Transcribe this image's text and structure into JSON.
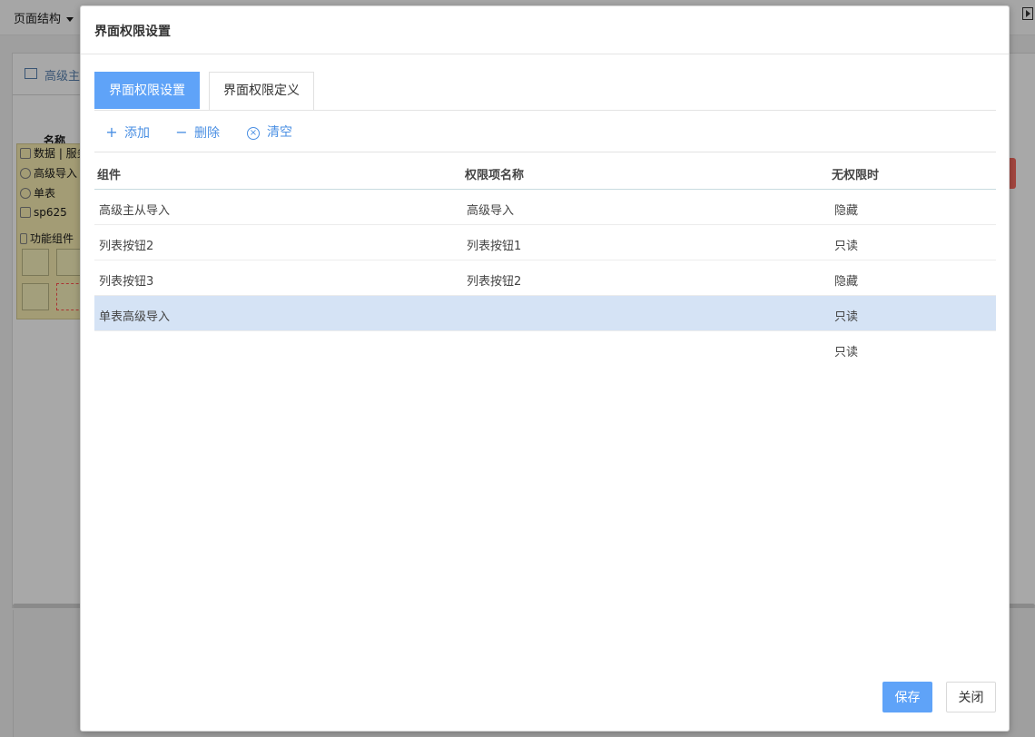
{
  "background": {
    "topbar_label": "页面结构",
    "tab_label": "高级主",
    "col_name": "名称",
    "tree": [
      {
        "icon": "database-icon",
        "label": "数据 | 服务"
      },
      {
        "icon": "component-icon",
        "label": "高级导入"
      },
      {
        "icon": "component-icon",
        "label": "单表"
      },
      {
        "icon": "d-icon",
        "label": "sp625"
      },
      {
        "icon": "function-icon",
        "label": "功能组件"
      }
    ]
  },
  "dialog": {
    "title": "界面权限设置",
    "tabs": [
      "界面权限设置",
      "界面权限定义"
    ],
    "toolbar": {
      "add": "添加",
      "delete": "删除",
      "clear": "清空"
    },
    "columns": [
      "组件",
      "权限项名称",
      "无权限时"
    ],
    "rows": [
      {
        "component": "高级主从导入",
        "permission": "高级导入",
        "no_permission": "隐藏"
      },
      {
        "component": "列表按钮2",
        "permission": "列表按钮1",
        "no_permission": "只读"
      },
      {
        "component": "列表按钮3",
        "permission": "列表按钮2",
        "no_permission": "隐藏"
      },
      {
        "component": "单表高级导入",
        "permission": "",
        "no_permission": "只读"
      },
      {
        "component": "",
        "permission": "",
        "no_permission": "只读"
      }
    ],
    "selected_row": 3,
    "buttons": {
      "save": "保存",
      "close": "关闭"
    },
    "colors": {
      "primary": "#5fa3f8",
      "link": "#4a8fe3",
      "selected_row": "#d5e3f5"
    }
  }
}
